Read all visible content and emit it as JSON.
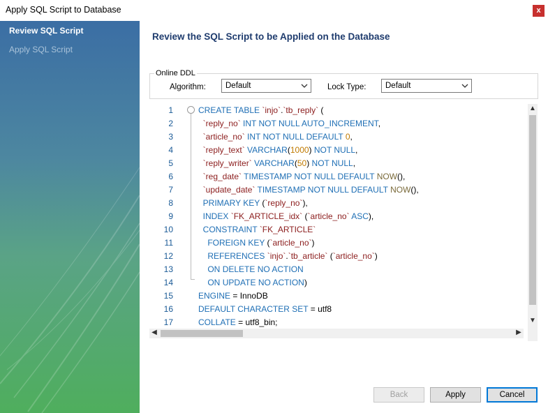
{
  "window": {
    "title": "Apply SQL Script to Database",
    "close_label": "x"
  },
  "sidebar": {
    "steps": [
      {
        "label": "Review SQL Script",
        "active": true
      },
      {
        "label": "Apply SQL Script",
        "active": false
      }
    ]
  },
  "main": {
    "heading": "Review the SQL Script to be Applied on the Database"
  },
  "online_ddl": {
    "legend": "Online DDL",
    "algorithm_label": "Algorithm:",
    "algorithm_value": "Default",
    "lock_type_label": "Lock Type:",
    "lock_type_value": "Default"
  },
  "editor": {
    "line_numbers": [
      "1",
      "2",
      "3",
      "4",
      "5",
      "6",
      "7",
      "8",
      "9",
      "10",
      "11",
      "12",
      "13",
      "14",
      "15",
      "16",
      "17"
    ],
    "lines": [
      "CREATE TABLE `injo`.`tb_reply` (",
      "  `reply_no` INT NOT NULL AUTO_INCREMENT,",
      "  `article_no` INT NOT NULL DEFAULT 0,",
      "  `reply_text` VARCHAR(1000) NOT NULL,",
      "  `reply_writer` VARCHAR(50) NOT NULL,",
      "  `reg_date` TIMESTAMP NOT NULL DEFAULT NOW(),",
      "  `update_date` TIMESTAMP NOT NULL DEFAULT NOW(),",
      "  PRIMARY KEY (`reply_no`),",
      "  INDEX `FK_ARTICLE_idx` (`article_no` ASC),",
      "  CONSTRAINT `FK_ARTICLE`",
      "    FOREIGN KEY (`article_no`)",
      "    REFERENCES `injo`.`tb_article` (`article_no`)",
      "    ON DELETE NO ACTION",
      "    ON UPDATE NO ACTION)",
      "ENGINE = InnoDB",
      "DEFAULT CHARACTER SET = utf8",
      "COLLATE = utf8_bin;"
    ]
  },
  "buttons": {
    "back": "Back",
    "apply": "Apply",
    "cancel": "Cancel"
  },
  "colors": {
    "heading": "#1f3c6e",
    "keyword": "#1f6fb5",
    "identifier": "#8b1c1c",
    "number": "#c07a00",
    "close": "#c7302e"
  },
  "icons": {
    "close": "close-icon",
    "dropdown": "chevron-down-icon",
    "fold": "fold-collapse-icon"
  }
}
